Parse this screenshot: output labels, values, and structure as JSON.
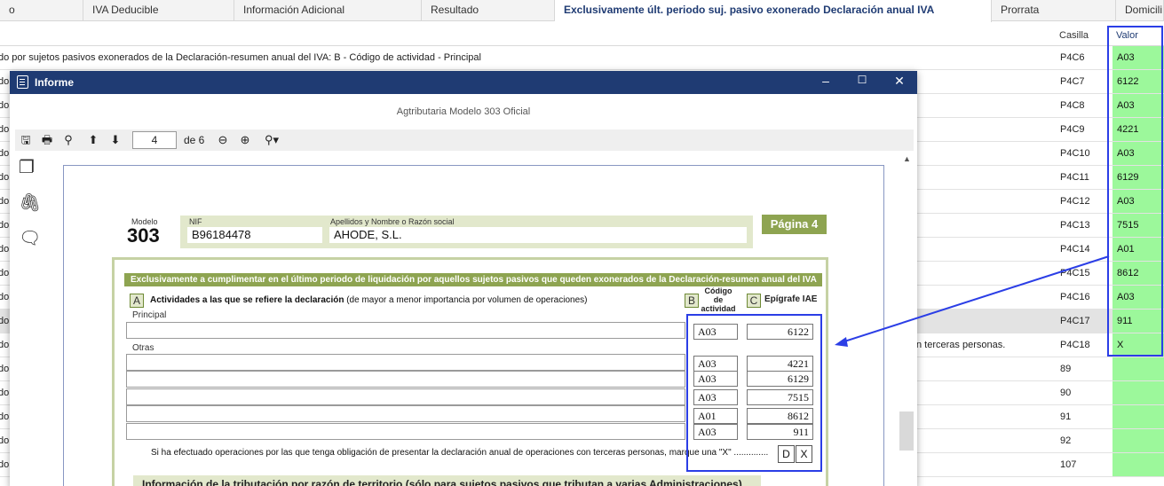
{
  "tabs": [
    {
      "label": "o"
    },
    {
      "label": "IVA Deducible"
    },
    {
      "label": "Información Adicional"
    },
    {
      "label": "Resultado"
    },
    {
      "label": "Exclusivamente últ. periodo suj. pasivo exonerado Declaración anual IVA",
      "active": true
    },
    {
      "label": "Prorrata"
    },
    {
      "label": "Domicili"
    }
  ],
  "grid": {
    "col_casilla": "Casilla",
    "col_valor": "Valor",
    "rows": [
      {
        "desc": "do por sujetos pasivos exonerados de la Declaración-resumen anual del IVA: B - Código de actividad - Principal",
        "casilla": "P4C6",
        "valor": "A03"
      },
      {
        "desc": "do",
        "casilla": "P4C7",
        "valor": "6122"
      },
      {
        "desc": "do",
        "casilla": "P4C8",
        "valor": "A03"
      },
      {
        "desc": "do",
        "casilla": "P4C9",
        "valor": "4221"
      },
      {
        "desc": "do",
        "casilla": "P4C10",
        "valor": "A03"
      },
      {
        "desc": "do",
        "casilla": "P4C11",
        "valor": "6129"
      },
      {
        "desc": "do",
        "casilla": "P4C12",
        "valor": "A03"
      },
      {
        "desc": "do",
        "casilla": "P4C13",
        "valor": "7515"
      },
      {
        "desc": "do",
        "casilla": "P4C14",
        "valor": "A01"
      },
      {
        "desc": "do",
        "casilla": "P4C15",
        "valor": "8612"
      },
      {
        "desc": "do",
        "casilla": "P4C16",
        "valor": "A03"
      },
      {
        "desc": "do",
        "casilla": "P4C17",
        "valor": "911",
        "selected": true
      },
      {
        "desc": "do",
        "tail": "n terceras personas.",
        "casilla": "P4C18",
        "valor": "X"
      },
      {
        "desc": "do",
        "casilla": "89",
        "valor": ""
      },
      {
        "desc": "do",
        "casilla": "90",
        "valor": ""
      },
      {
        "desc": "do",
        "casilla": "91",
        "valor": ""
      },
      {
        "desc": "do",
        "casilla": "92",
        "valor": ""
      },
      {
        "desc": "do",
        "casilla": "107",
        "valor": ""
      }
    ]
  },
  "window": {
    "title": "Informe",
    "minimize": "–",
    "maximize": "☐",
    "close": "✕",
    "report_title": "Agtributaria Modelo 303 Oficial",
    "page_current": "4",
    "page_of": "de 6"
  },
  "form": {
    "modelo_label": "Modelo",
    "modelo_num": "303",
    "nif_label": "NIF",
    "nif": "B96184478",
    "razon_label": "Apellidos y Nombre o Razón social",
    "razon": "AHODE, S.L.",
    "pagina": "Página 4",
    "section_title": "Exclusivamente a cumplimentar en el último periodo de liquidación por aquellos sujetos pasivos que queden exonerados de la Declaración-resumen anual del IVA",
    "box_a": "A",
    "actividades_bold": "Actividades a las que se refiere la declaración",
    "actividades_rest": " (de mayor a menor importancia por volumen de operaciones)",
    "box_b": "B",
    "codigo": "Código de actividad",
    "box_c": "C",
    "epigrafe": "Epígrafe IAE",
    "principal_label": "Principal",
    "otras_label": "Otras",
    "principal": {
      "codigo": "A03",
      "epigrafe": "6122"
    },
    "otras": [
      {
        "codigo": "A03",
        "epigrafe": "4221"
      },
      {
        "codigo": "A03",
        "epigrafe": "6129"
      },
      {
        "codigo": "A03",
        "epigrafe": "7515"
      },
      {
        "codigo": "A01",
        "epigrafe": "8612"
      },
      {
        "codigo": "A03",
        "epigrafe": "911"
      }
    ],
    "note": "Si ha efectuado operaciones por las que tenga obligación de presentar la declaración anual de operaciones con terceras personas, marque una \"X\" ..............",
    "box_d": "D",
    "box_x": "X",
    "section2": "Información de la tributación por razón de territorio (sólo para sujetos pasivos que tributan a varias Administraciones)"
  },
  "colors": {
    "title_bar": "#1f3b73",
    "valor_fill": "#9cf89b",
    "highlight": "#2b3ee6",
    "form_green": "#8ea451"
  }
}
